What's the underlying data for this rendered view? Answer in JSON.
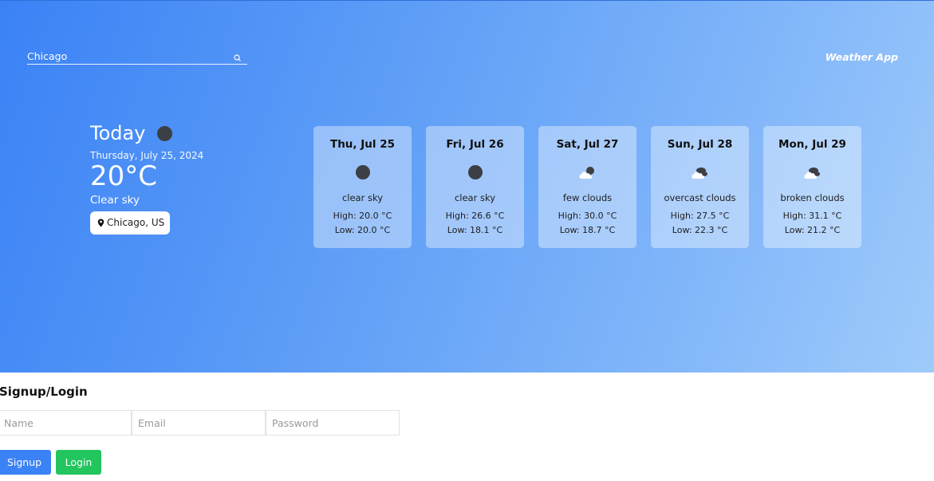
{
  "header": {
    "search_value": "Chicago",
    "search_icon": "search-icon",
    "brand": "Weather App"
  },
  "today": {
    "title": "Today",
    "date": "Thursday, July 25, 2024",
    "temp": "20°C",
    "description": "Clear sky",
    "location": "Chicago, US",
    "location_icon": "map-pin-icon"
  },
  "forecast": [
    {
      "day": "Thu, Jul 25",
      "icon": "clear-sky-icon",
      "description": "clear sky",
      "high": "High: 20.0 °C",
      "low": "Low: 20.0 °C"
    },
    {
      "day": "Fri, Jul 26",
      "icon": "clear-sky-icon",
      "description": "clear sky",
      "high": "High: 26.6 °C",
      "low": "Low: 18.1 °C"
    },
    {
      "day": "Sat, Jul 27",
      "icon": "few-clouds-icon",
      "description": "few clouds",
      "high": "High: 30.0 °C",
      "low": "Low: 18.7 °C"
    },
    {
      "day": "Sun, Jul 28",
      "icon": "overcast-clouds-icon",
      "description": "overcast clouds",
      "high": "High: 27.5 °C",
      "low": "Low: 22.3 °C"
    },
    {
      "day": "Mon, Jul 29",
      "icon": "broken-clouds-icon",
      "description": "broken clouds",
      "high": "High: 31.1 °C",
      "low": "Low: 21.2 °C"
    }
  ],
  "auth": {
    "title": "Signup/Login",
    "name_placeholder": "Name",
    "email_placeholder": "Email",
    "password_placeholder": "Password",
    "signup_label": "Signup",
    "login_label": "Login"
  },
  "colors": {
    "gradient_start": "#3b82f6",
    "gradient_end": "#9fcbfb",
    "signup_button": "#3b82f6",
    "login_button": "#22c55e"
  }
}
